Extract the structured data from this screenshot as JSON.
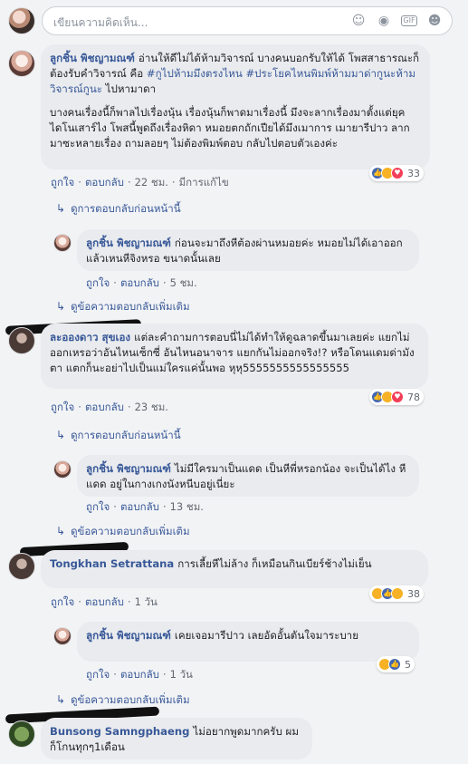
{
  "composer": {
    "placeholder": "เขียนความคิดเห็น...",
    "icons": [
      "smile-icon",
      "camera-icon",
      "gif-icon",
      "sticker-icon"
    ]
  },
  "comments": [
    {
      "author": "ลูกชิ้น พิชญามณฑ์",
      "text1": "อ่านให้ดีไม่ได้ห้ามวิจารณ์ บางคนบอกรับให้ได้ โพสสาธารณะก็ต้องรับคำวิจารณ์ คือ ",
      "hashtag1": "#กูไปห้ามมึงตรงไหน",
      "hashtag2": "#ประโยคไหนพิมพ์ห้ามมาด่ากูนะห้ามวิจารณ์กูนะ",
      "text1_end": " ไปหามาดา",
      "text2": "บางคนเรื่องนี้ก็พาลไปเรื่องนุ้น เรื่องนุ้นก็พาดมาเรื่องนี้ มึงจะลากเรื่องมาตั้งแต่ยุคไดโนเสาร์ไง โพสนี้พูดถึงเรื่องหิดา หมอยตกถักเปียได้มึงเมาการ เมายารีปาว ลากมาซะหลายเรื่อง ถามลอยๆ ไม่ต้องพิมพ์ตอบ กลับไปตอบตัวเองค่ะ",
      "reactions": "33",
      "like": "ถูกใจ",
      "reply": "ตอบกลับ",
      "time": "22 ชม.",
      "edited": "มีการแก้ไข",
      "prev_replies": "ดูการตอบกลับก่อนหน้านี้"
    },
    {
      "author": "ลูกชิ้น พิชญามณฑ์",
      "text": "ก่อนจะมาถึงหีต้องผ่านหมอยค่ะ หมอยไม่ได้เอาออก แล้วเหนหีจิงหรอ ขนาดนั้นเลย",
      "like": "ถูกใจ",
      "reply": "ตอบกลับ",
      "time": "5 ชม.",
      "more_replies": "ดูข้อความตอบกลับเพิ่มเติม"
    },
    {
      "author": "ละอองดาว สุขเอง",
      "text": "แต่ละคำถามการตอบนี่ไม่ได้ทำให้ดูฉลาดขึ้นมาเลยค่ะ แยกไม่ออกเหรอว่าอันไหนเซ็กซี่ อันไหนอนาจาร แยกกันไม่ออกจริง!? หรือโดนแดมด่ามังตา แตกก็นะอย่าไปเป็นแม่ใครแค่นั้นพอ หุหุ5555555555555555",
      "reactions": "78",
      "like": "ถูกใจ",
      "reply": "ตอบกลับ",
      "time": "23 ชม.",
      "prev_replies": "ดูการตอบกลับก่อนหน้านี้"
    },
    {
      "author": "ลูกชิ้น พิชญามณฑ์",
      "text": "ไม่มีใครมาเป็นแดด เป็นหีพี่หรอกน้อง จะเป็นได้ไง หี แดด อยู่ในกางเกงนังหนีบอยู่เนี่ยะ",
      "like": "ถูกใจ",
      "reply": "ตอบกลับ",
      "time": "13 ชม.",
      "more_replies": "ดูข้อความตอบกลับเพิ่มเติม"
    },
    {
      "author": "Tongkhan Setrattana",
      "text": "การเลี้ยหีไม่ล้าง ก็เหมือนกินเบียร์ช้างไม่เย็น",
      "reactions": "38",
      "like": "ถูกใจ",
      "reply": "ตอบกลับ",
      "time": "1 วัน"
    },
    {
      "author": "ลูกชิ้น พิชญามณฑ์",
      "text": "เคยเจอมารีปาว เลยอัดอั้นตันใจมาระบาย",
      "reactions": "5",
      "like": "ถูกใจ",
      "reply": "ตอบกลับ",
      "time": "1 วัน",
      "more_replies": "ดูข้อความตอบกลับเพิ่มเติม"
    },
    {
      "author": "Bunsong Samngphaeng",
      "text": "ไม่อยากพูดมากครับ ผมก็โกนทุกๆ1เดือน"
    }
  ],
  "sep": "·"
}
